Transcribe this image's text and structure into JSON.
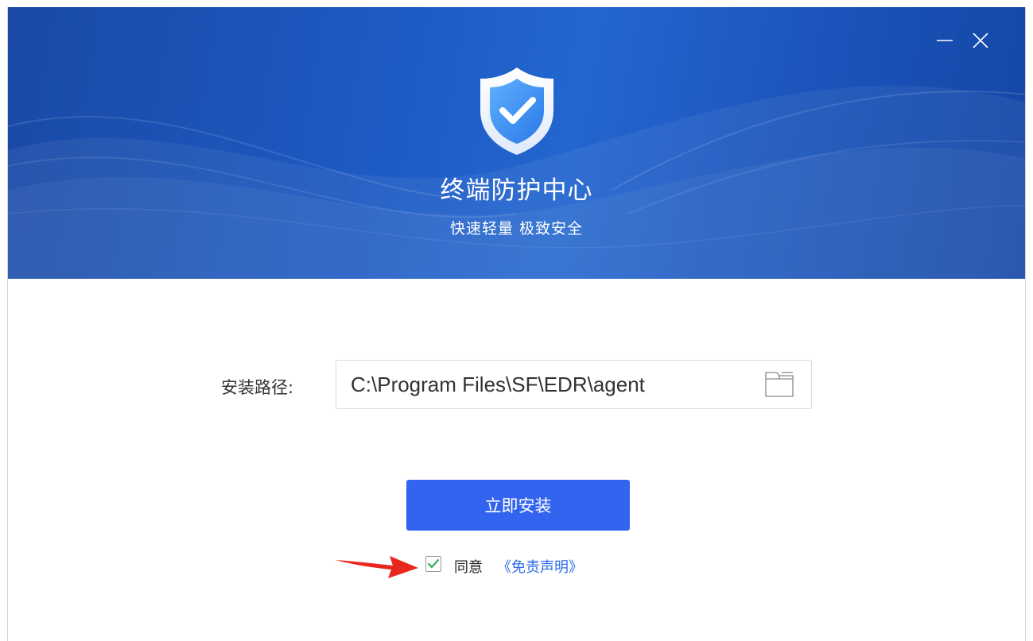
{
  "window": {
    "minimize_icon": "minimize-icon",
    "close_icon": "close-icon"
  },
  "header": {
    "logo_icon": "shield-check-icon",
    "title": "终端防护中心",
    "subtitle": "快速轻量 极致安全",
    "colors": {
      "gradient_start": "#1a49a6",
      "gradient_mid": "#2366cf",
      "gradient_end": "#1446a6"
    }
  },
  "install_path": {
    "label": "安装路径:",
    "value": "C:\\Program Files\\SF\\EDR\\agent",
    "browse_icon": "folder-icon"
  },
  "install_button": {
    "label": "立即安装",
    "color": "#3364f0"
  },
  "agreement": {
    "checked": true,
    "agree_label": "同意",
    "link_label": "《免责声明》",
    "link_color": "#2b6be8",
    "check_color": "#1aa64b"
  },
  "annotation": {
    "arrow_icon": "red-arrow-icon",
    "arrow_color": "#e8271e"
  }
}
